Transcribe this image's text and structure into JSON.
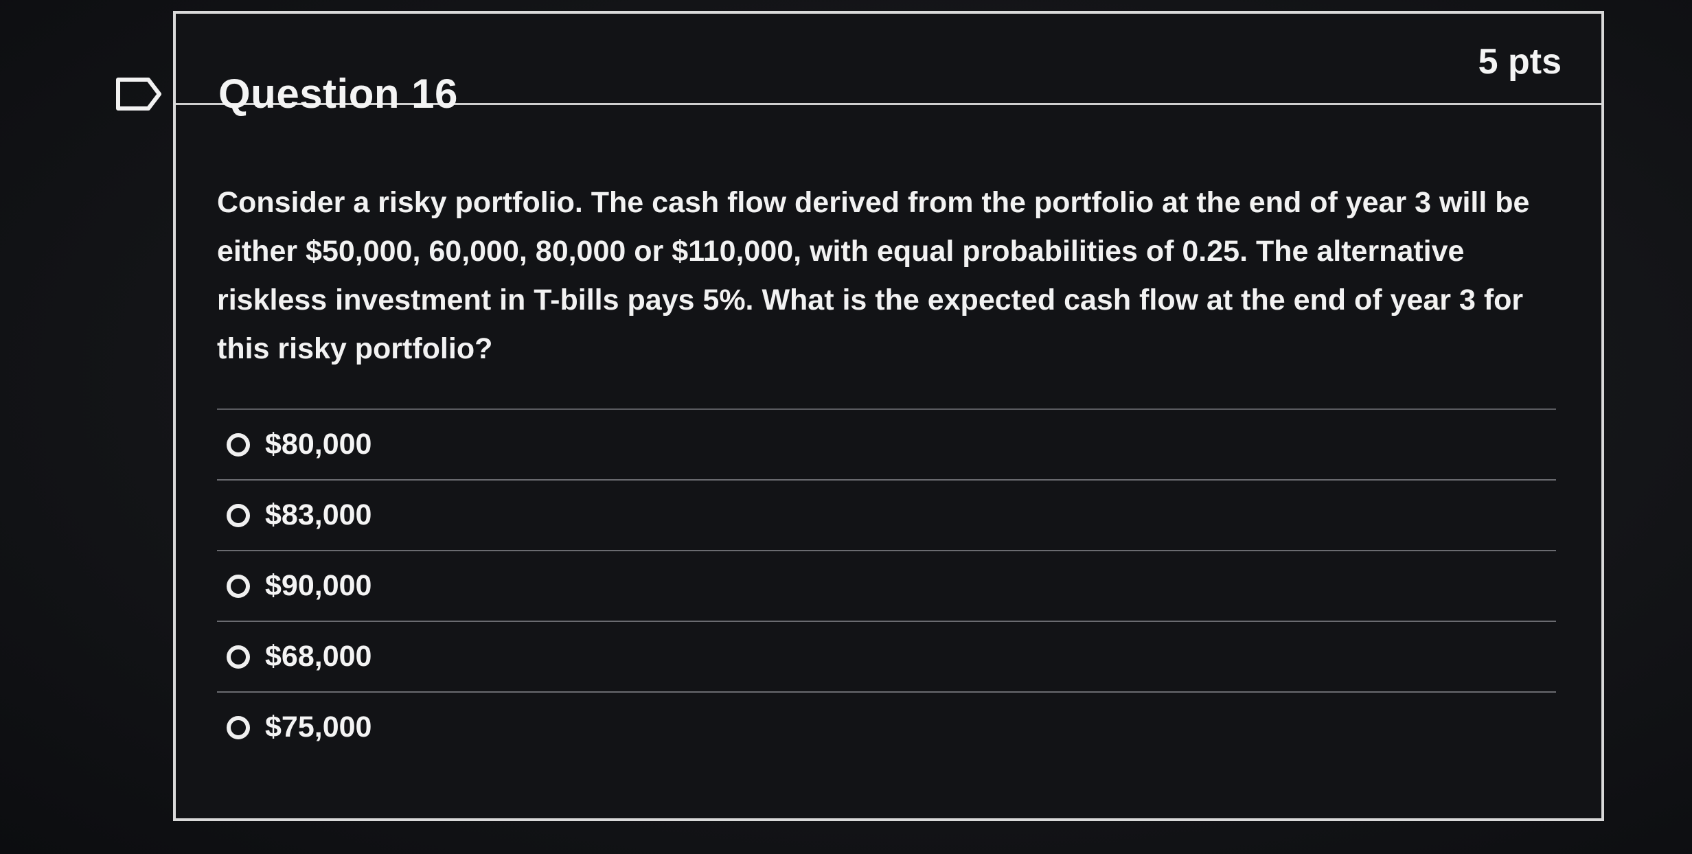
{
  "question": {
    "title": "Question 16",
    "points": "5 pts",
    "text": "Consider a risky portfolio. The cash flow derived from the portfolio at the end of year 3 will be either $50,000, 60,000, 80,000 or $110,000, with equal probabilities of 0.25. The alternative riskless investment in T-bills pays 5%. What is the expected cash flow at the end of year 3 for this risky portfolio?",
    "flag_icon": "flag-marker-icon"
  },
  "answers": [
    {
      "label": "$80,000"
    },
    {
      "label": "$83,000"
    },
    {
      "label": "$90,000"
    },
    {
      "label": "$68,000"
    },
    {
      "label": "$75,000"
    }
  ]
}
